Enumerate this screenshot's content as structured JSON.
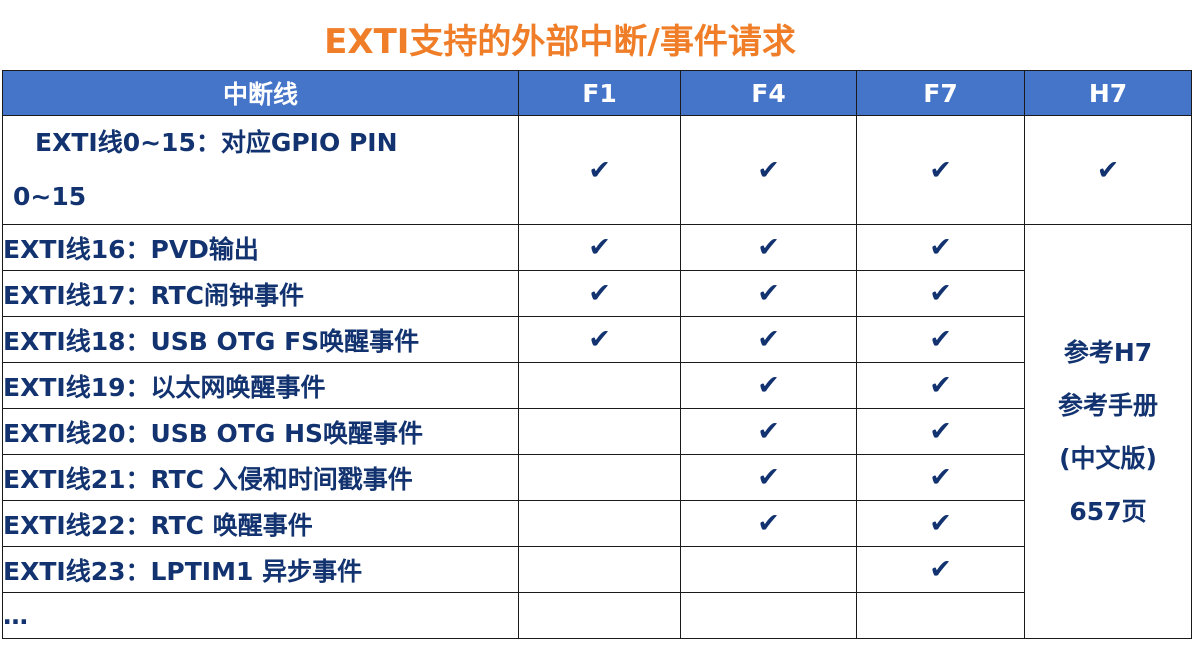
{
  "title": "EXTI支持的外部中断/事件请求",
  "table": {
    "headers": [
      "中断线",
      "F1",
      "F4",
      "F7",
      "H7"
    ],
    "check_glyph": "✔",
    "rows": [
      {
        "name_line1": "EXTI线0~15：对应GPIO PIN",
        "name_line2": "0~15",
        "f1": "✔",
        "f4": "✔",
        "f7": "✔",
        "h7": "✔"
      },
      {
        "name": "EXTI线16：PVD输出",
        "f1": "✔",
        "f4": "✔",
        "f7": "✔"
      },
      {
        "name": "EXTI线17：RTC闹钟事件",
        "f1": "✔",
        "f4": "✔",
        "f7": "✔"
      },
      {
        "name": "EXTI线18：USB OTG FS唤醒事件",
        "f1": "✔",
        "f4": "✔",
        "f7": "✔"
      },
      {
        "name": "EXTI线19：以太网唤醒事件",
        "f1": "",
        "f4": "✔",
        "f7": "✔"
      },
      {
        "name": "EXTI线20：USB OTG HS唤醒事件",
        "f1": "",
        "f4": "✔",
        "f7": "✔"
      },
      {
        "name": "EXTI线21：RTC 入侵和时间戳事件",
        "f1": "",
        "f4": "✔",
        "f7": "✔"
      },
      {
        "name": "EXTI线22：RTC 唤醒事件",
        "f1": "",
        "f4": "✔",
        "f7": "✔"
      },
      {
        "name": "EXTI线23：LPTIM1 异步事件",
        "f1": "",
        "f4": "",
        "f7": "✔"
      },
      {
        "name": "…",
        "f1": "",
        "f4": "",
        "f7": ""
      }
    ],
    "h7_note": [
      "参考H7",
      "参考手册",
      "(中文版)",
      "657页"
    ]
  }
}
